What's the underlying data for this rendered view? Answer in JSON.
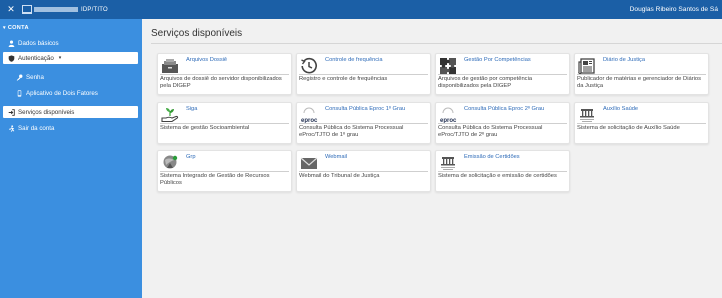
{
  "topbar": {
    "close_glyph": "✕",
    "brand_name": "IDP/TITO",
    "user_name": "Douglas Ribeiro Santos de Sá"
  },
  "sidebar": {
    "section_label": "CONTA",
    "items": [
      {
        "label": "Dados básicos",
        "icon": "user-icon"
      },
      {
        "label": "Autenticação",
        "icon": "shield-icon"
      },
      {
        "label": "Senha",
        "icon": "key-icon"
      },
      {
        "label": "Aplicativo de Dois Fatores",
        "icon": "phone-icon"
      },
      {
        "label": "Serviços disponíveis",
        "icon": "signin-icon"
      },
      {
        "label": "Sair da conta",
        "icon": "logout-icon"
      }
    ]
  },
  "main": {
    "title": "Serviços disponíveis",
    "cards": [
      {
        "name": "Arquivos Dossiê",
        "desc": "Arquivos de dossiê do servidor disponibilizados pela DIGEP",
        "icon": "archive-icon"
      },
      {
        "name": "Controle de frequência",
        "desc": "Registro e controle de frequências",
        "icon": "history-icon"
      },
      {
        "name": "Gestão Por Competências",
        "desc": "Arquivos de gestão por competência disponibilizados pela DIGEP",
        "icon": "puzzle-icon"
      },
      {
        "name": "Diário de Justiça",
        "desc": "Publicador de matérias e gerenciador de Diários da Justiça",
        "icon": "newspaper-icon"
      },
      {
        "name": "Siga",
        "desc": "Sistema de gestão Socioambiental",
        "icon": "plant-hand-icon"
      },
      {
        "name": "Consulta Pública Eproc 1º Grau",
        "desc": "Consulta Pública do Sistema Processual eProc/TJTO de 1º grau",
        "icon": "eproc-icon",
        "logo_text": "eproc"
      },
      {
        "name": "Consulta Pública Eproc 2º Grau",
        "desc": "Consulta Pública do Sistema Processual eProc/TJTO de 2º grau",
        "icon": "eproc-icon",
        "logo_text": "eproc"
      },
      {
        "name": "Auxílio Saúde",
        "desc": "Sistema de solicitação de Auxílio Saúde",
        "icon": "tribunal-icon"
      },
      {
        "name": "Grp",
        "desc": "Sistema Integrado de Gestão de Recursos Públicos",
        "icon": "grp-icon"
      },
      {
        "name": "Webmail",
        "desc": "Webmail do Tribunal de Justiça",
        "icon": "mail-icon"
      },
      {
        "name": "Emissão de Certidões",
        "desc": "Sistema de solicitação e emissão de certidões",
        "icon": "tribunal-icon"
      }
    ]
  }
}
